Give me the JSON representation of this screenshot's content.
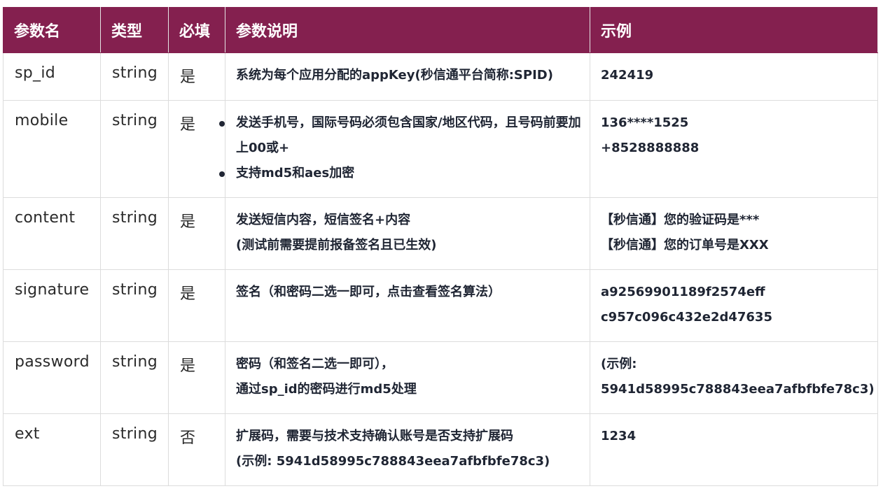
{
  "headers": {
    "name": "参数名",
    "type": "类型",
    "required": "必填",
    "desc": "参数说明",
    "example": "示例"
  },
  "rows": [
    {
      "name": "sp_id",
      "type": "string",
      "required": "是",
      "desc": [
        "系统为每个应用分配的appKey(秒信通平台简称:SPID)"
      ],
      "example": [
        "242419"
      ]
    },
    {
      "name": "mobile",
      "type": "string",
      "required": "是",
      "desc_bullets": [
        "发送手机号，国际号码必须包含国家/地区代码，且号码前要加上00或+",
        "支持md5和aes加密"
      ],
      "example": [
        "136****1525",
        "+8528888888"
      ]
    },
    {
      "name": "content",
      "type": "string",
      "required": "是",
      "desc": [
        "发送短信内容，短信签名+内容",
        "(测试前需要提前报备签名且已生效)"
      ],
      "example": [
        "【秒信通】您的验证码是***",
        "【秒信通】您的订单号是XXX"
      ]
    },
    {
      "name": "signature",
      "type": "string",
      "required": "是",
      "desc": [
        "签名（和密码二选一即可，点击查看签名算法）"
      ],
      "example": [
        "a92569901189f2574eff",
        "c957c096c432e2d47635"
      ]
    },
    {
      "name": "password",
      "type": "string",
      "required": "是",
      "desc": [
        "密码（和签名二选一即可），",
        "通过sp_id的密码进行md5处理"
      ],
      "example": [
        "(示例:",
        "5941d58995c788843eea7afbfbfe78c3)"
      ]
    },
    {
      "name": "ext",
      "type": "string",
      "required": "否",
      "desc": [
        "扩展码，需要与技术支持确认账号是否支持扩展码",
        "(示例: 5941d58995c788843eea7afbfbfe78c3)"
      ],
      "example": [
        "1234"
      ]
    }
  ]
}
